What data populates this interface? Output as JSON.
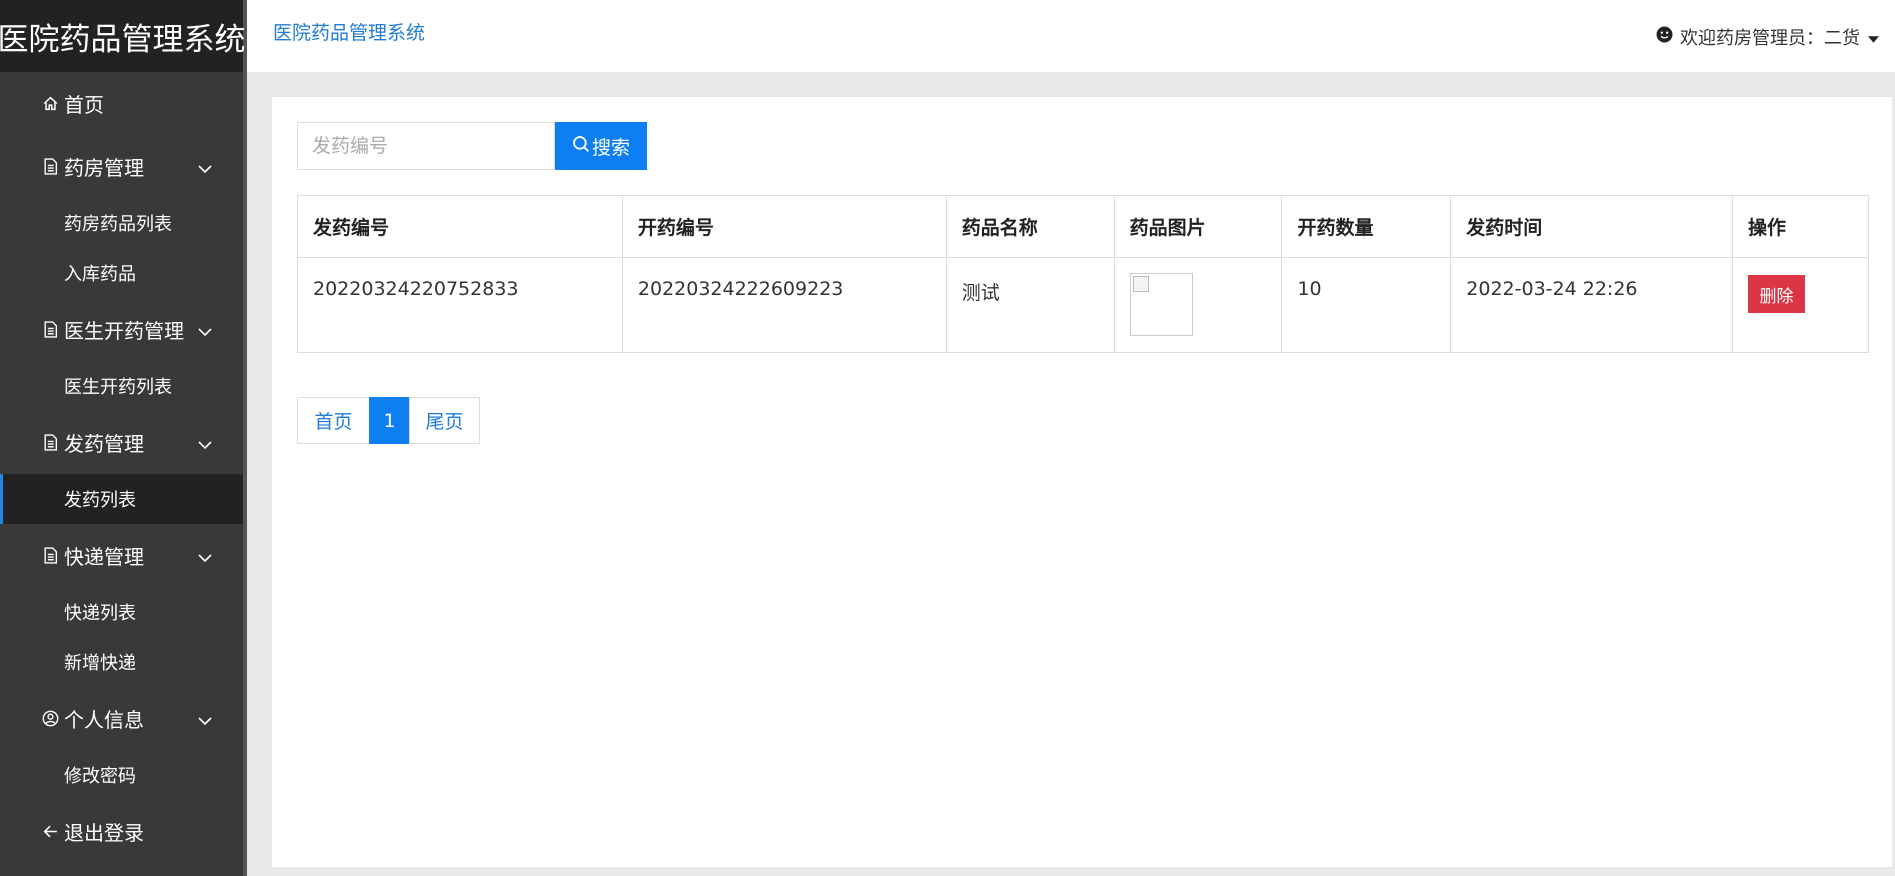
{
  "app": {
    "brand": "医院药品管理系统",
    "header_title": "医院药品管理系统",
    "welcome": "欢迎药房管理员：二货"
  },
  "sidebar": {
    "home": "首页",
    "groups": [
      {
        "label": "药房管理",
        "icon": "document-icon",
        "items": [
          "药房药品列表",
          "入库药品"
        ]
      },
      {
        "label": "医生开药管理",
        "icon": "document-icon",
        "items": [
          "医生开药列表"
        ]
      },
      {
        "label": "发药管理",
        "icon": "document-icon",
        "items": [
          "发药列表"
        ]
      },
      {
        "label": "快递管理",
        "icon": "document-icon",
        "items": [
          "快递列表",
          "新增快递"
        ]
      },
      {
        "label": "个人信息",
        "icon": "user-circle-icon",
        "items": [
          "修改密码"
        ]
      }
    ],
    "active_item": "发药列表",
    "logout": "退出登录"
  },
  "search": {
    "placeholder": "发药编号",
    "value": "",
    "button": "搜索"
  },
  "table": {
    "columns": [
      "发药编号",
      "开药编号",
      "药品名称",
      "药品图片",
      "开药数量",
      "发药时间",
      "操作"
    ],
    "rows": [
      {
        "dispense_no": "20220324220752833",
        "prescription_no": "20220324222609223",
        "drug_name": "测试",
        "quantity": "10",
        "time": "2022-03-24 22:26",
        "action": "删除"
      }
    ]
  },
  "pagination": {
    "first": "首页",
    "current": "1",
    "last": "尾页"
  },
  "colors": {
    "primary": "#0d7ff2",
    "danger": "#dc3545",
    "sidebar": "#393939",
    "brand_bg": "#222222",
    "active_bar": "#1e88e5"
  }
}
